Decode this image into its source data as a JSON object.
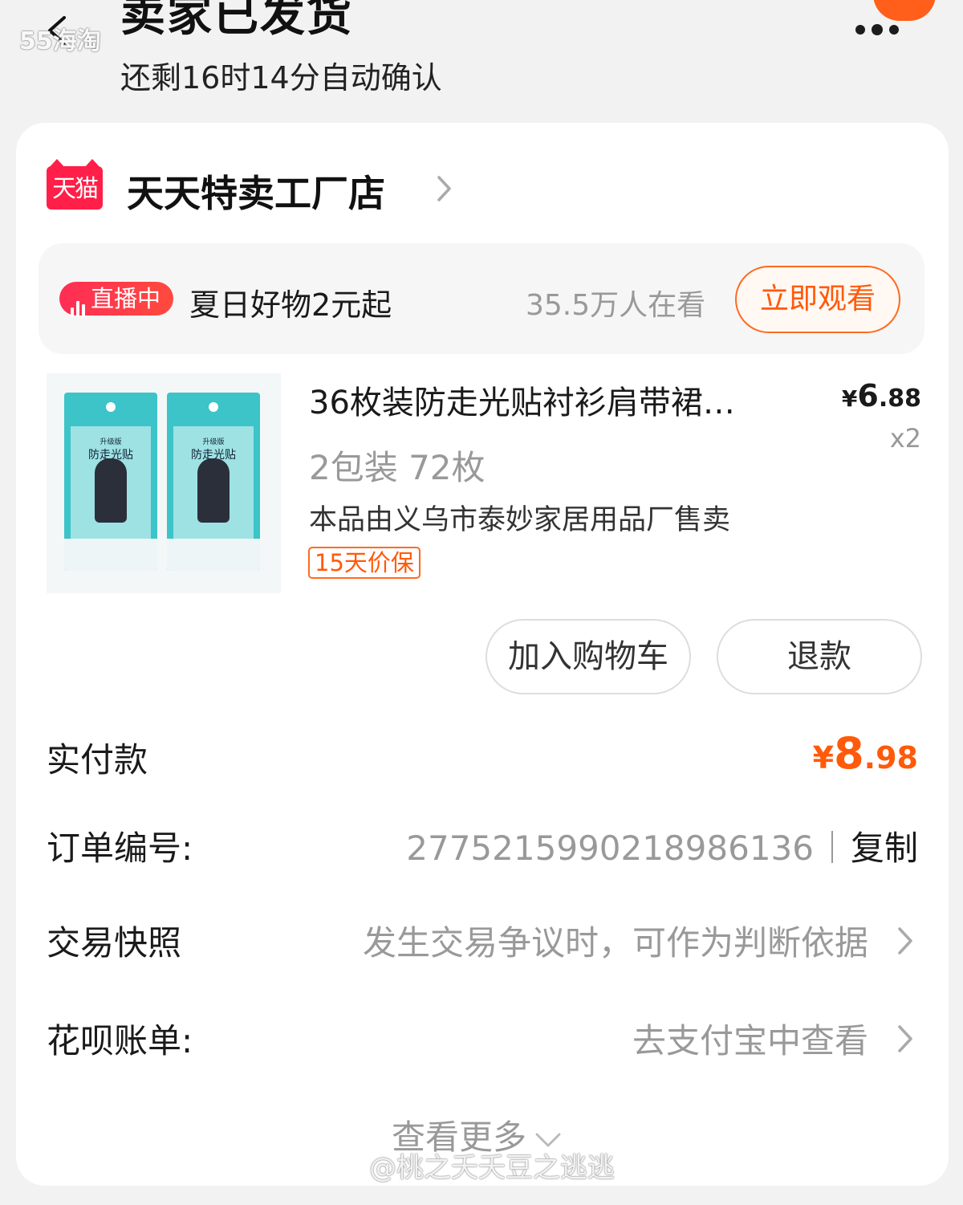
{
  "header": {
    "title": "卖家已发货",
    "subtitle": "还剩16时14分自动确认",
    "watermark_top": "55海淘"
  },
  "store": {
    "badge": "天猫",
    "name": "天天特卖工厂店"
  },
  "live": {
    "badge": "直播中",
    "promo": "夏日好物2元起",
    "viewers": "35.5万人在看",
    "watch_button": "立即观看"
  },
  "product": {
    "title": "36枚装防走光贴衬衫肩带裙…",
    "price_symbol": "¥",
    "price_int": "6",
    "price_dec": ".88",
    "qty": "x2",
    "spec": "2包装  72枚",
    "seller": "本品由义乌市泰妙家居用品厂售卖",
    "tag": "15天价保",
    "image_label": "防走光贴",
    "image_top_label": "升级版"
  },
  "actions": {
    "add_cart": "加入购物车",
    "refund": "退款"
  },
  "payment": {
    "label": "实付款",
    "symbol": "¥",
    "int": "8",
    "dec": ".98"
  },
  "order": {
    "label": "订单编号:",
    "number": "2775215990218986136",
    "copy": "复制"
  },
  "snapshot": {
    "label": "交易快照",
    "value": "发生交易争议时，可作为判断依据"
  },
  "huabei": {
    "label": "花呗账单:",
    "value": "去支付宝中查看"
  },
  "see_more": "查看更多",
  "watermark_bottom": "@桃之夭夭豆之逃逃",
  "colors": {
    "accent": "#ff5a0a",
    "tmall_red": "#ff1f48",
    "live_red": "#fe2c55",
    "muted": "#999999"
  }
}
